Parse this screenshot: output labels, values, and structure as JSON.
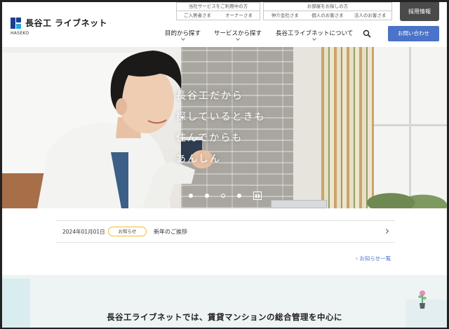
{
  "header": {
    "logo_text": "長谷工 ライブネット",
    "logo_sub": "HASEKO",
    "topbox1": {
      "title": "当社サービスをご利用中の方",
      "items": [
        "ご入居者さま",
        "オーナーさま"
      ]
    },
    "topbox2": {
      "title": "お部屋をお探しの方",
      "items": [
        "仲介会社さま",
        "個人のお客さま",
        "法人のお客さま"
      ]
    },
    "recruit_label": "採用情報",
    "nav": [
      "目的から探す",
      "サービスから探す",
      "長谷工ライブネットについて"
    ],
    "contact_label": "お問い合わせ"
  },
  "hero": {
    "lines": [
      "長谷工だから",
      "探しているときも",
      "住んでからも",
      "あんしん"
    ],
    "slide_count": 4,
    "active_slide": 3
  },
  "news": {
    "date": "2024年01月01日",
    "badge": "お知らせ",
    "title": "新年のご挨拶",
    "more_label": "お知らせ一覧"
  },
  "intro": {
    "heading": "長谷工ライブネットでは、賃貸マンションの総合管理を中心に"
  },
  "colors": {
    "accent_blue": "#4a73c9",
    "logo_navy": "#1d3f8f",
    "badge_yellow": "#e3c338",
    "recruit_bg": "#4a4a4a"
  }
}
